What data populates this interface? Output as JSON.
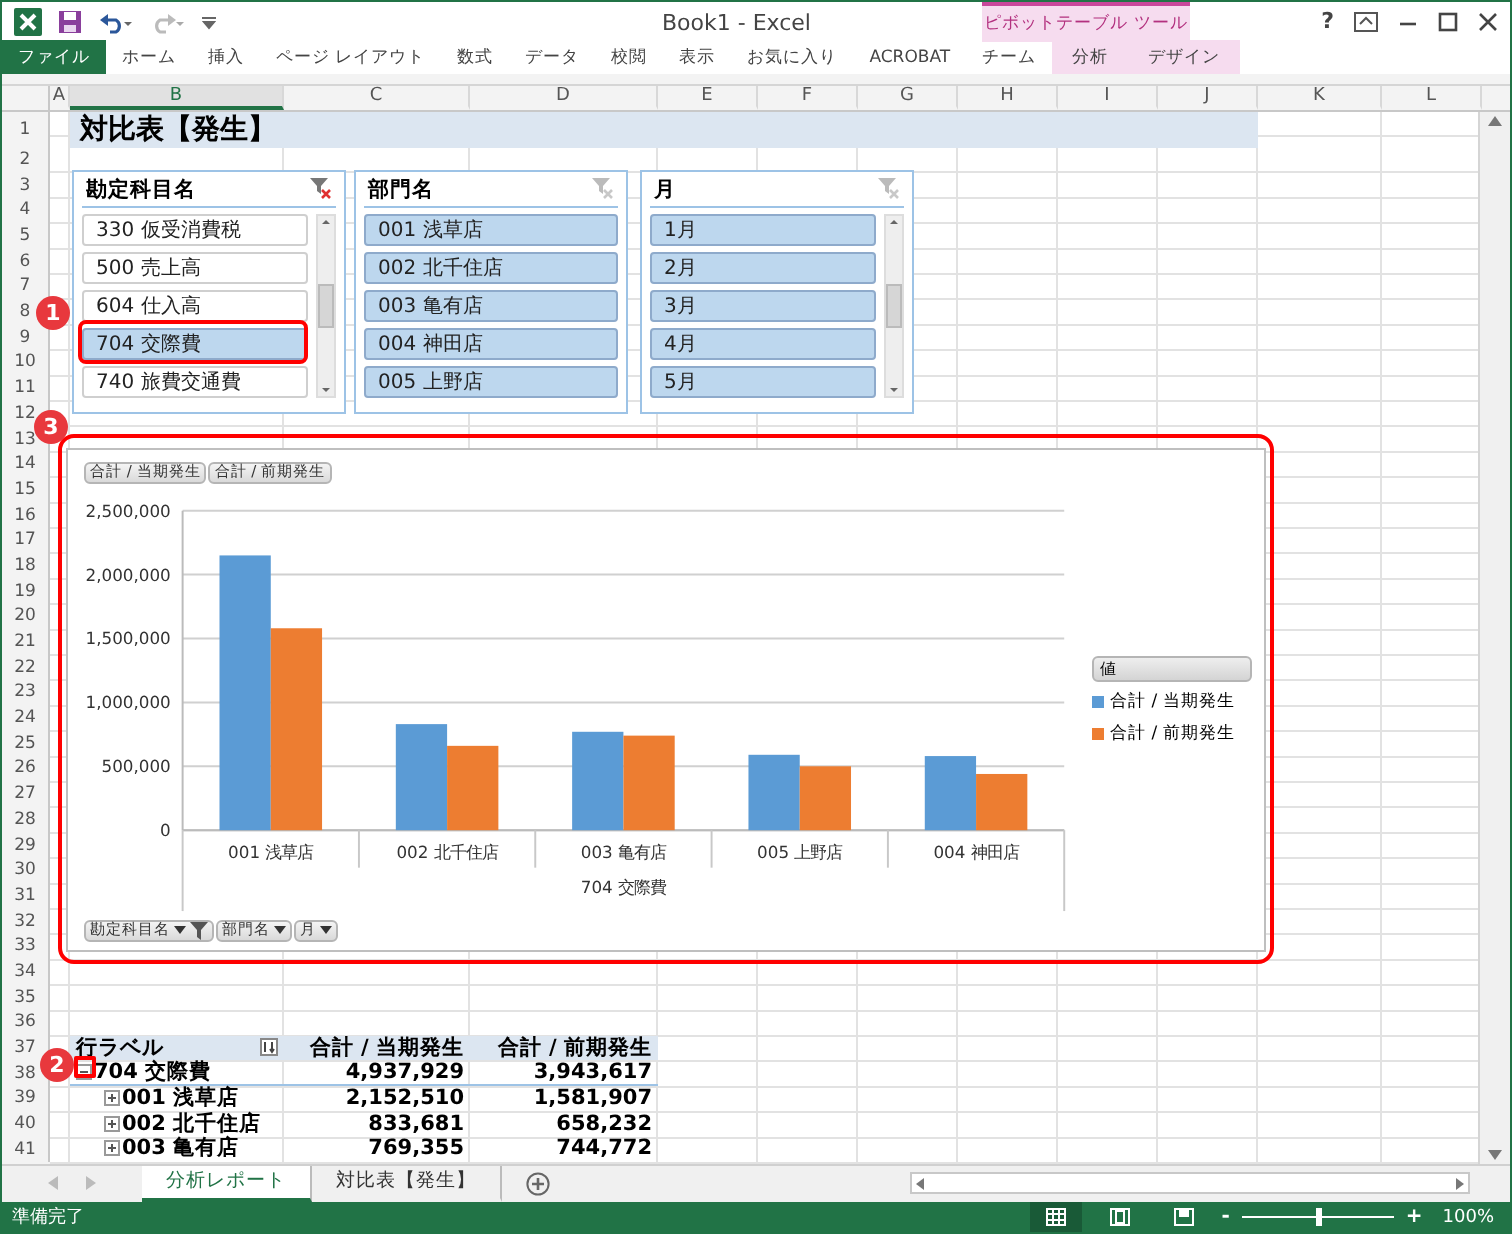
{
  "window": {
    "title": "Book1 - Excel",
    "context_label": "ピボットテーブル ツール",
    "help": "?"
  },
  "ribbon_tabs": [
    {
      "label": "ファイル",
      "kind": "file"
    },
    {
      "label": "ホーム",
      "kind": "normal"
    },
    {
      "label": "挿入",
      "kind": "normal"
    },
    {
      "label": "ページ レイアウト",
      "kind": "normal"
    },
    {
      "label": "数式",
      "kind": "normal"
    },
    {
      "label": "データ",
      "kind": "normal"
    },
    {
      "label": "校閲",
      "kind": "normal"
    },
    {
      "label": "表示",
      "kind": "normal"
    },
    {
      "label": "お気に入り",
      "kind": "normal"
    },
    {
      "label": "ACROBAT",
      "kind": "normal"
    },
    {
      "label": "チーム",
      "kind": "normal"
    },
    {
      "label": "分析",
      "kind": "context"
    },
    {
      "label": "デザイン",
      "kind": "context"
    }
  ],
  "sheet": {
    "columns": [
      {
        "label": "A",
        "selected": false
      },
      {
        "label": "B",
        "selected": true
      },
      {
        "label": "C",
        "selected": false
      },
      {
        "label": "D",
        "selected": false
      },
      {
        "label": "E",
        "selected": false
      },
      {
        "label": "F",
        "selected": false
      },
      {
        "label": "G",
        "selected": false
      },
      {
        "label": "H",
        "selected": false
      },
      {
        "label": "I",
        "selected": false
      },
      {
        "label": "J",
        "selected": false
      },
      {
        "label": "K",
        "selected": false
      },
      {
        "label": "L",
        "selected": false
      }
    ],
    "row_numbers": [
      "1",
      "2",
      "3",
      "4",
      "5",
      "6",
      "7",
      "8",
      "9",
      "10",
      "11",
      "12",
      "13",
      "14",
      "15",
      "16",
      "17",
      "18",
      "19",
      "20",
      "21",
      "22",
      "23",
      "24",
      "25",
      "26",
      "27",
      "28",
      "29",
      "30",
      "31",
      "32",
      "33",
      "34",
      "35",
      "36",
      "37",
      "38",
      "39",
      "40",
      "41"
    ],
    "title": "対比表【発生】"
  },
  "slicers": [
    {
      "title": "勘定科目名",
      "filter_active": true,
      "scrollable": true,
      "items": [
        {
          "label": "330 仮受消費税",
          "selected": false
        },
        {
          "label": "500 売上高",
          "selected": false
        },
        {
          "label": "604 仕入高",
          "selected": false
        },
        {
          "label": "704 交際費",
          "selected": true
        },
        {
          "label": "740 旅費交通費",
          "selected": false
        }
      ]
    },
    {
      "title": "部門名",
      "filter_active": false,
      "scrollable": false,
      "items": [
        {
          "label": "001 浅草店",
          "selected": true
        },
        {
          "label": "002 北千住店",
          "selected": true
        },
        {
          "label": "003 亀有店",
          "selected": true
        },
        {
          "label": "004 神田店",
          "selected": true
        },
        {
          "label": "005 上野店",
          "selected": true
        }
      ]
    },
    {
      "title": "月",
      "filter_active": false,
      "scrollable": true,
      "items": [
        {
          "label": "1月",
          "selected": true
        },
        {
          "label": "2月",
          "selected": true
        },
        {
          "label": "3月",
          "selected": true
        },
        {
          "label": "4月",
          "selected": true
        },
        {
          "label": "5月",
          "selected": true
        }
      ]
    }
  ],
  "chart": {
    "field_buttons_top": [
      "合計 / 当期発生",
      "合計 / 前期発生"
    ],
    "field_buttons_bottom": [
      {
        "label": "勘定科目名",
        "filtered": true
      },
      {
        "label": "部門名",
        "filtered": false
      },
      {
        "label": "月",
        "filtered": false
      }
    ],
    "legend_title": "値",
    "chart_data": {
      "type": "bar",
      "grid": true,
      "xlabel": "704 交際費",
      "categories": [
        "001 浅草店",
        "002 北千住店",
        "003 亀有店",
        "005 上野店",
        "004 神田店"
      ],
      "series": [
        {
          "name": "合計 / 当期発生",
          "color": "#5b9bd5",
          "values": [
            2150000,
            830000,
            770000,
            590000,
            580000
          ]
        },
        {
          "name": "合計 / 前期発生",
          "color": "#ed7d31",
          "values": [
            1580000,
            660000,
            740000,
            500000,
            440000
          ]
        }
      ],
      "ylim": [
        0,
        2500000
      ],
      "yticks": [
        {
          "value": 0,
          "label": "0"
        },
        {
          "value": 500000,
          "label": "500,000"
        },
        {
          "value": 1000000,
          "label": "1,000,000"
        },
        {
          "value": 1500000,
          "label": "1,500,000"
        },
        {
          "value": 2000000,
          "label": "2,000,000"
        },
        {
          "value": 2500000,
          "label": "2,500,000"
        }
      ]
    }
  },
  "pivot_table": {
    "row_label": "行ラベル",
    "columns": [
      "合計 / 当期発生",
      "合計 / 前期発生"
    ],
    "rows": [
      {
        "label": "704 交際費",
        "values": [
          "4,937,929",
          "3,943,617"
        ],
        "expanded": true,
        "children": [
          {
            "label": "001 浅草店",
            "values": [
              "2,152,510",
              "1,581,907"
            ],
            "expanded": false
          },
          {
            "label": "002 北千住店",
            "values": [
              "833,681",
              "658,232"
            ],
            "expanded": false
          },
          {
            "label": "003 亀有店",
            "values": [
              "769,355",
              "744,772"
            ],
            "expanded": false
          }
        ]
      }
    ]
  },
  "callouts": [
    "1",
    "3",
    "2"
  ],
  "sheet_tabs": [
    {
      "label": "分析レポート",
      "selected": true
    },
    {
      "label": "対比表【発生】",
      "selected": false
    }
  ],
  "status_bar": {
    "text": "準備完了",
    "zoom": {
      "minus": "-",
      "plus": "+",
      "level": 0.5,
      "reading": "100%"
    }
  }
}
